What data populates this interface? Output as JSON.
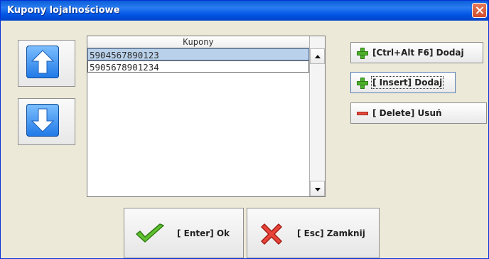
{
  "window": {
    "title": "Kupony lojalnościowe"
  },
  "list": {
    "header": "Kupony",
    "items": [
      {
        "label": "5904567890123",
        "selected": true
      },
      {
        "label": "5905678901234",
        "selected": false
      }
    ]
  },
  "actions": {
    "add_ctrl_label": "[Ctrl+Alt F6] Dodaj",
    "add_insert_label": "[ Insert] Dodaj",
    "delete_label": "[ Delete] Usuń"
  },
  "footer": {
    "ok_label": "[ Enter] Ok",
    "cancel_label": "[ Esc] Zamknij"
  },
  "icons": {
    "move_up": "arrow-up-icon",
    "move_down": "arrow-down-icon",
    "add": "plus-icon",
    "delete": "minus-icon",
    "ok": "checkmark-icon",
    "cancel": "x-icon",
    "close": "close-icon"
  },
  "colors": {
    "titlebar": "#0a5ed8",
    "selection": "#b9d1ea",
    "add": "#4caf2a",
    "delete": "#e24a3c"
  }
}
